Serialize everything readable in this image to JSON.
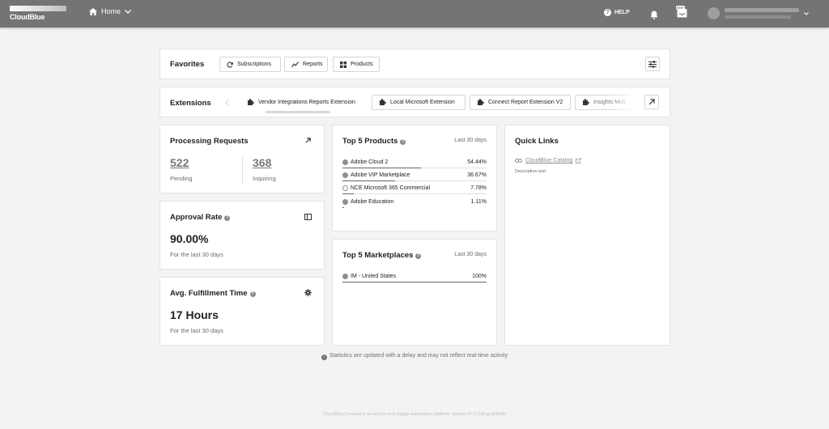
{
  "header": {
    "logo_text": "CloudBlue",
    "nav_label": "Home",
    "help_label": "HELP",
    "inbox_badge": "999+"
  },
  "favorites": {
    "title": "Favorites",
    "items": [
      {
        "label": "Subscriptions",
        "icon": "refresh-icon"
      },
      {
        "label": "Reports",
        "icon": "chart-icon"
      },
      {
        "label": "Products",
        "icon": "grid-icon"
      }
    ]
  },
  "extensions": {
    "title": "Extensions",
    "items": [
      {
        "label": "Vendor Integrations Reports Extension",
        "icon": "puzzle-icon"
      },
      {
        "label": "Local Microsoft Extension",
        "icon": "puzzle-icon"
      },
      {
        "label": "Connect Report Extension V2",
        "icon": "puzzle-icon"
      },
      {
        "label": "Insights Mult",
        "icon": "puzzle-icon"
      }
    ]
  },
  "processing": {
    "title": "Processing Requests",
    "pending_value": "522",
    "pending_label": "Pending",
    "inquiring_value": "368",
    "inquiring_label": "Inquiring"
  },
  "approval": {
    "title": "Approval Rate",
    "value": "90.00%",
    "period": "For the last 30 days"
  },
  "fulfillment": {
    "title": "Avg. Fulfillment Time",
    "value": "17 Hours",
    "period": "For the last 30 days"
  },
  "top_products": {
    "title": "Top 5 Products",
    "period": "Last 30 days",
    "rows": [
      {
        "name": "Adobe Cloud 2",
        "value": "54.44%",
        "fraction": 0.5444
      },
      {
        "name": "Adobe VIP Marketplace",
        "value": "36.67%",
        "fraction": 0.3667
      },
      {
        "name": "NCE Microsoft 365 Commercial",
        "value": "7.78%",
        "fraction": 0.0778
      },
      {
        "name": "Adobe Education",
        "value": "1.11%",
        "fraction": 0.0111
      }
    ]
  },
  "top_marketplaces": {
    "title": "Top 5 Marketplaces",
    "period": "Last 30 days",
    "rows": [
      {
        "name": "IM - United States",
        "value": "100%",
        "fraction": 1.0
      }
    ]
  },
  "quick_links": {
    "title": "Quick Links",
    "link_label": "CloudBlue Catalog",
    "description": "Description test"
  },
  "footnote": "Statistics are updated with a delay and may not reflect real-time activity",
  "footer": "CloudBlue Connect is an end-to-end supply automation platform, version 37.0.220-gca0840b"
}
